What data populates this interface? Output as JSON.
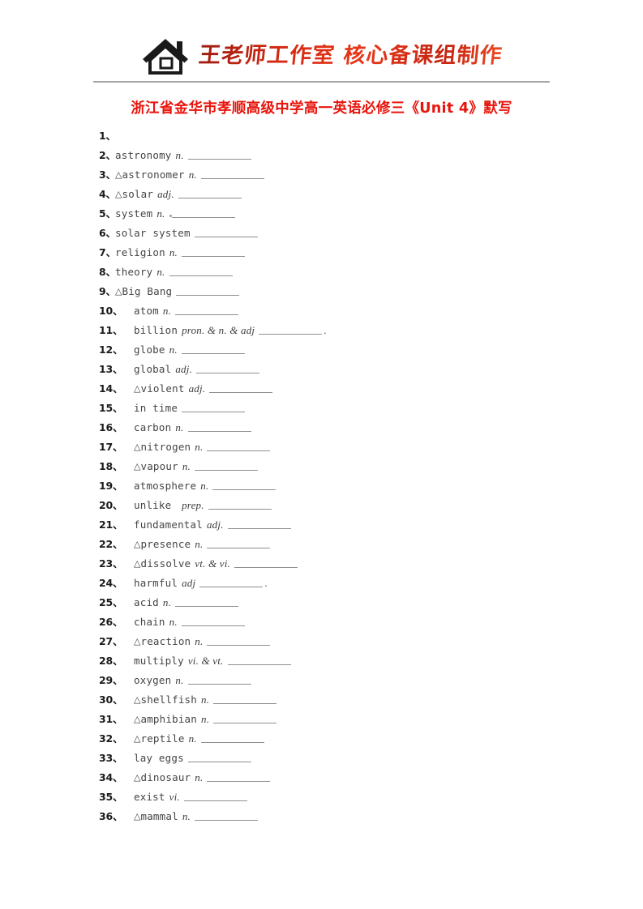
{
  "header": {
    "logo_icon": "house-logo-icon",
    "brand_text": "王老师工作室 核心备课组制作",
    "brand_color": "#d42a12"
  },
  "title": {
    "text": "浙江省金华市孝顺高级中学高一英语必修三《Unit 4》默写",
    "color": "#e8140c"
  },
  "list": {
    "number_suffix": "、",
    "triangle_marker": "△",
    "items": [
      {
        "num": "1",
        "tri": "",
        "term": "",
        "pos": "",
        "blank": 0,
        "tail": ""
      },
      {
        "num": "2",
        "tri": "",
        "term": "astronomy",
        "pos": "n.",
        "blank": 78,
        "tail": ""
      },
      {
        "num": "3",
        "tri": "△",
        "term": "astronomer",
        "pos": "n.",
        "blank": 78,
        "tail": ""
      },
      {
        "num": "4",
        "tri": "△",
        "term": "solar",
        "pos": "adj.",
        "blank": 78,
        "tail": ""
      },
      {
        "num": "5",
        "tri": "",
        "term": "system",
        "pos": "n.",
        "blank": 78,
        "tail": ""
      },
      {
        "num": "6",
        "tri": "",
        "term": "solar system",
        "pos": "",
        "blank": 78,
        "tail": ""
      },
      {
        "num": "7",
        "tri": "",
        "term": "religion",
        "pos": "n.",
        "blank": 78,
        "tail": ""
      },
      {
        "num": "8",
        "tri": "",
        "term": "theory",
        "pos": "n.",
        "blank": 78,
        "tail": ""
      },
      {
        "num": "9",
        "tri": "△",
        "term": "Big Bang",
        "pos": "",
        "blank": 78,
        "tail": ""
      },
      {
        "num": "10",
        "tri": "",
        "term": "atom",
        "pos": "n.",
        "blank": 78,
        "tail": ""
      },
      {
        "num": "11",
        "tri": "",
        "term": "billion",
        "pos": "pron. & n. & adj",
        "blank": 78,
        "tail": "."
      },
      {
        "num": "12",
        "tri": "",
        "term": "globe",
        "pos": "n.",
        "blank": 78,
        "tail": ""
      },
      {
        "num": "13",
        "tri": "",
        "term": "global",
        "pos": "adj.",
        "blank": 78,
        "tail": ""
      },
      {
        "num": "14",
        "tri": "△",
        "term": "violent",
        "pos": "adj.",
        "blank": 78,
        "tail": ""
      },
      {
        "num": "15",
        "tri": "",
        "term": "in time",
        "pos": "",
        "blank": 78,
        "tail": ""
      },
      {
        "num": "16",
        "tri": "",
        "term": "carbon",
        "pos": "n.",
        "blank": 78,
        "tail": ""
      },
      {
        "num": "17",
        "tri": "△",
        "term": "nitrogen",
        "pos": "n.",
        "blank": 78,
        "tail": ""
      },
      {
        "num": "18",
        "tri": "△",
        "term": "vapour",
        "pos": "n.",
        "blank": 78,
        "tail": ""
      },
      {
        "num": "19",
        "tri": "",
        "term": "atmosphere",
        "pos": "n.",
        "blank": 78,
        "tail": ""
      },
      {
        "num": "20",
        "tri": "",
        "term": "unlike ",
        "pos": "prep.",
        "blank": 78,
        "tail": ""
      },
      {
        "num": "21",
        "tri": "",
        "term": "fundamental",
        "pos": "adj.",
        "blank": 78,
        "tail": ""
      },
      {
        "num": "22",
        "tri": "△",
        "term": "presence",
        "pos": "n.",
        "blank": 78,
        "tail": ""
      },
      {
        "num": "23",
        "tri": "△",
        "term": "dissolve",
        "pos": "vt. & vi.",
        "blank": 78,
        "tail": ""
      },
      {
        "num": "24",
        "tri": "",
        "term": "harmful",
        "pos": "adj",
        "blank": 78,
        "tail": "."
      },
      {
        "num": "25",
        "tri": "",
        "term": "acid",
        "pos": "n.",
        "blank": 78,
        "tail": ""
      },
      {
        "num": "26",
        "tri": "",
        "term": "chain",
        "pos": "n.",
        "blank": 78,
        "tail": ""
      },
      {
        "num": "27",
        "tri": "△",
        "term": "reaction",
        "pos": "n.",
        "blank": 78,
        "tail": ""
      },
      {
        "num": "28",
        "tri": "",
        "term": "multiply",
        "pos": "vi. & vt.",
        "blank": 78,
        "tail": ""
      },
      {
        "num": "29",
        "tri": "",
        "term": "oxygen",
        "pos": "n.",
        "blank": 78,
        "tail": ""
      },
      {
        "num": "30",
        "tri": "△",
        "term": "shellfish",
        "pos": "n.",
        "blank": 78,
        "tail": ""
      },
      {
        "num": "31",
        "tri": "△",
        "term": "amphibian",
        "pos": "n.",
        "blank": 78,
        "tail": ""
      },
      {
        "num": "32",
        "tri": "△",
        "term": "reptile",
        "pos": "n.",
        "blank": 78,
        "tail": ""
      },
      {
        "num": "33",
        "tri": "",
        "term": "lay eggs",
        "pos": "",
        "blank": 78,
        "tail": ""
      },
      {
        "num": "34",
        "tri": "△",
        "term": "dinosaur",
        "pos": "n.",
        "blank": 78,
        "tail": ""
      },
      {
        "num": "35",
        "tri": "",
        "term": "exist",
        "pos": "vi.",
        "blank": 78,
        "tail": ""
      },
      {
        "num": "36",
        "tri": "△",
        "term": "mammal",
        "pos": "n.",
        "blank": 78,
        "tail": ""
      }
    ]
  }
}
